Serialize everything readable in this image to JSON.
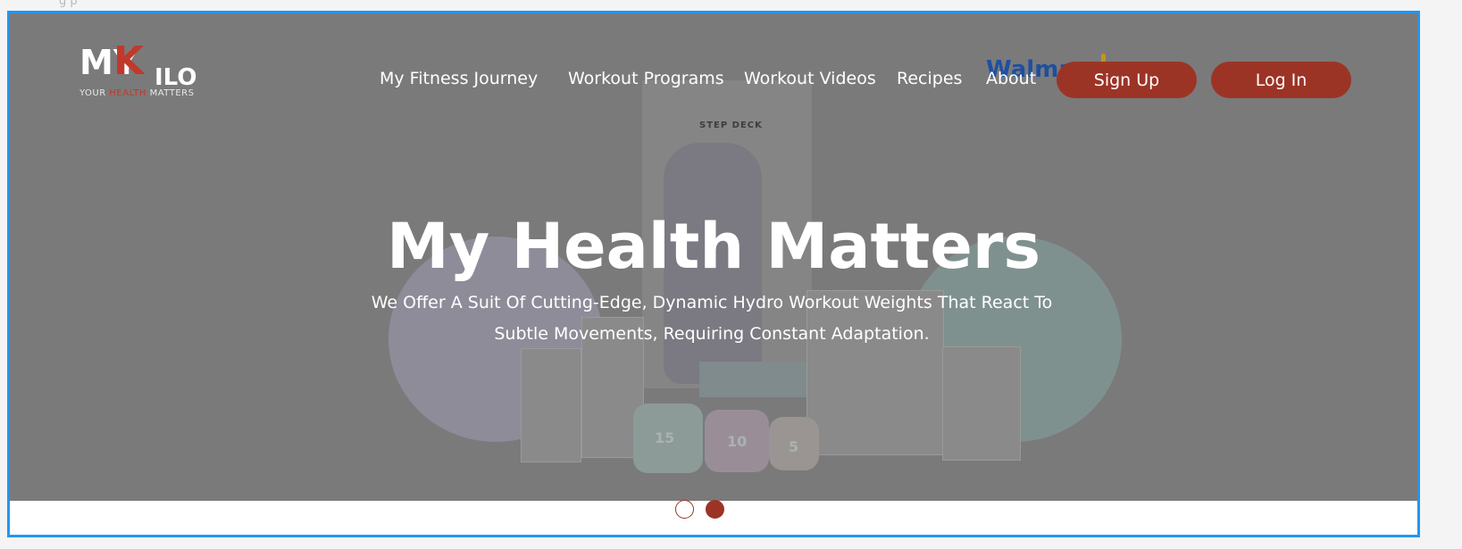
{
  "page": {
    "top_fragment": "g  p"
  },
  "logo": {
    "mark_my": "MY",
    "mark_k": "K",
    "mark_ilo": "ILO",
    "sub_prefix": "YOUR ",
    "sub_accent": "HEALTH",
    "sub_suffix": " MATTERS"
  },
  "nav": {
    "items": [
      "My Fitness Journey",
      "Workout Programs",
      "Workout Videos",
      "Recipes",
      "About"
    ]
  },
  "sponsor": {
    "partial_text": "Walma"
  },
  "auth": {
    "signup_label": "Sign Up",
    "login_label": "Log In"
  },
  "hero": {
    "title": "My Health Matters",
    "subtitle": "We Offer A Suit Of Cutting-Edge, Dynamic Hydro Workout Weights That React To Subtle Movements, Requiring Constant Adaptation.",
    "product_label": "STEP DECK",
    "dumbbell_numbers": [
      "15",
      "10",
      "5"
    ]
  },
  "carousel": {
    "slide_count": 2,
    "active_index": 1
  },
  "colors": {
    "accent": "#9c3426",
    "frame_border": "#2196f3",
    "overlay": "#7a7a7a"
  },
  "icons": {
    "carousel_dot": "circle"
  }
}
